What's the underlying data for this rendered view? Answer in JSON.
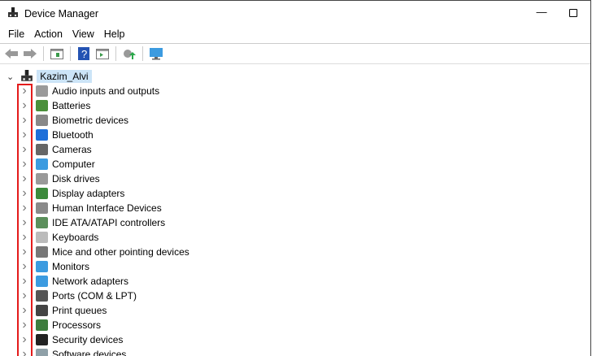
{
  "window": {
    "title": "Device Manager",
    "minimize": "—"
  },
  "menu": [
    "File",
    "Action",
    "View",
    "Help"
  ],
  "toolbar": [
    "back-icon",
    "forward-icon",
    "properties-pane-icon",
    "help-icon",
    "update-driver-icon",
    "scan-hardware-icon",
    "monitor-icon"
  ],
  "tree": {
    "root": "Kazim_Alvi",
    "items": [
      {
        "label": "Audio inputs and outputs",
        "color": "#9a9a9a"
      },
      {
        "label": "Batteries",
        "color": "#4a8f3a"
      },
      {
        "label": "Biometric devices",
        "color": "#888888"
      },
      {
        "label": "Bluetooth",
        "color": "#1e6fd9"
      },
      {
        "label": "Cameras",
        "color": "#666666"
      },
      {
        "label": "Computer",
        "color": "#3c9be0"
      },
      {
        "label": "Disk drives",
        "color": "#999999"
      },
      {
        "label": "Display adapters",
        "color": "#3c8a3c"
      },
      {
        "label": "Human Interface Devices",
        "color": "#8a8a8a"
      },
      {
        "label": "IDE ATA/ATAPI controllers",
        "color": "#5b8f5b"
      },
      {
        "label": "Keyboards",
        "color": "#bbbbbb"
      },
      {
        "label": "Mice and other pointing devices",
        "color": "#777777"
      },
      {
        "label": "Monitors",
        "color": "#3c9be0"
      },
      {
        "label": "Network adapters",
        "color": "#3c9be0"
      },
      {
        "label": "Ports (COM & LPT)",
        "color": "#555555"
      },
      {
        "label": "Print queues",
        "color": "#444444"
      },
      {
        "label": "Processors",
        "color": "#3e7d3e"
      },
      {
        "label": "Security devices",
        "color": "#222222"
      },
      {
        "label": "Software devices",
        "color": "#8fa0a8"
      }
    ]
  },
  "highlight_color": "#e41b1b"
}
